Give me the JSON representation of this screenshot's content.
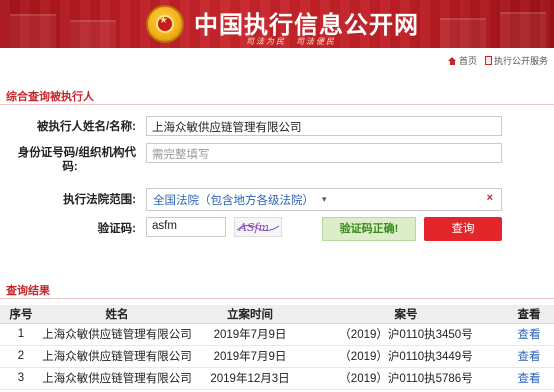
{
  "header": {
    "site_title": "中国执行信息公开网",
    "slogan": "司法为民　司法便民",
    "links": [
      {
        "label": "首页",
        "icon": "home-icon"
      },
      {
        "label": "执行公开服务",
        "icon": "page-icon"
      }
    ]
  },
  "query_section": {
    "title": "综合查询被执行人",
    "fields": {
      "name_label": "被执行人姓名/名称:",
      "name_value": "上海众敏供应链管理有限公司",
      "id_label_line1": "身份证号码/组织机构代",
      "id_label_line2": "码:",
      "id_placeholder": "需完整填写",
      "court_label": "执行法院范围:",
      "court_value": "全国法院（包含地方各级法院）",
      "captcha_label": "验证码:",
      "captcha_value": "asfm",
      "captcha_image_text": "ASfm"
    },
    "captcha_status": "验证码正确!",
    "query_button": "查询"
  },
  "results_section": {
    "title": "查询结果",
    "columns": [
      "序号",
      "姓名",
      "立案时间",
      "案号",
      "查看"
    ],
    "rows": [
      [
        "1",
        "上海众敏供应链管理有限公司",
        "2019年7月9日",
        "（2019）沪0110执3450号",
        "查看"
      ],
      [
        "2",
        "上海众敏供应链管理有限公司",
        "2019年7月9日",
        "（2019）沪0110执3449号",
        "查看"
      ],
      [
        "3",
        "上海众敏供应链管理有限公司",
        "2019年12月3日",
        "（2019）沪0110执5786号",
        "查看"
      ]
    ]
  },
  "colors": {
    "brand_red": "#c8252b",
    "link_blue": "#2a64b8",
    "success_green": "#3a8a1e"
  }
}
